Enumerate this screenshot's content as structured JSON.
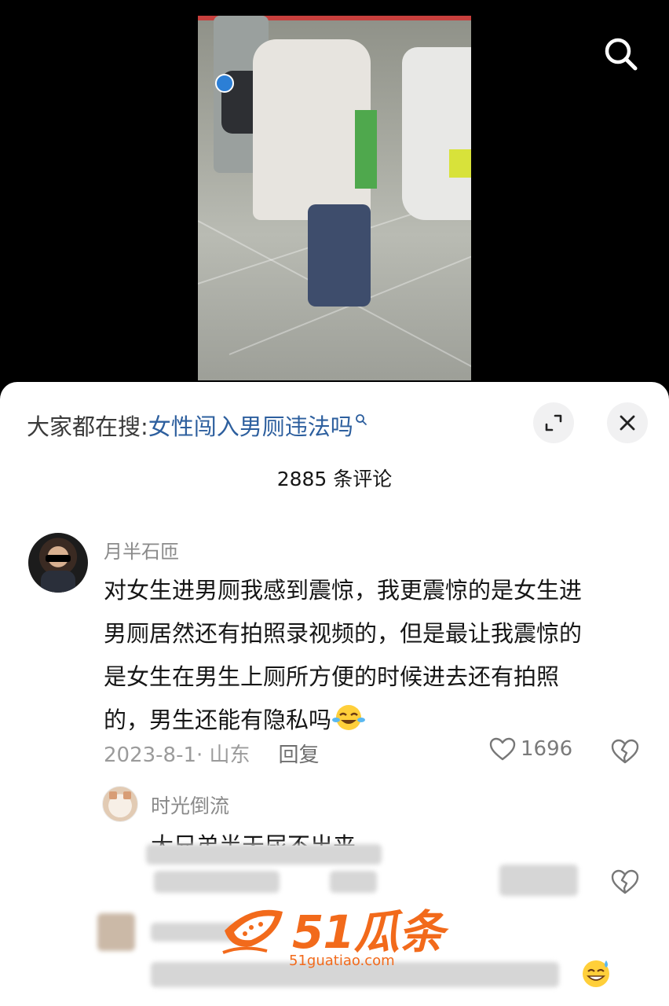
{
  "video": {
    "badge_text": "",
    "watermark": "",
    "search_icon": "search-icon"
  },
  "panel": {
    "hot_search_prefix": "大家都在搜:",
    "hot_search_query": "女性闯入男厕违法吗",
    "expand_icon": "expand-icon",
    "close_icon": "close-icon",
    "comment_count": "2885 条评论"
  },
  "comments": [
    {
      "username": "月半石匝",
      "text": "对女生进男厕我感到震惊，我更震惊的是女生进男厕居然还有拍照录视频的，但是最让我震惊的是女生在男生上厕所方便的时候进去还有拍照的，男生还能有隐私吗",
      "lines": [
        "对女生进男厕我感到震惊，我更震惊的是女生进",
        "男厕居然还有拍照录视频的，但是最让我震惊的",
        "是女生在男生上厕所方便的时候进去还有拍照",
        "的，男生还能有隐私吗"
      ],
      "emoji": "laughing-crying-emoji",
      "date": "2023-8-1",
      "location": "· 山东",
      "reply_label": "回复",
      "likes": "1696"
    }
  ],
  "reply": {
    "username": "时光倒流",
    "text": "大兄弟半天尿不出来"
  },
  "watermark_logo": {
    "brand": "51瓜条",
    "domain": "51guatiao.com"
  },
  "colors": {
    "link": "#2d5f9e",
    "brand": "#f26a1b",
    "muted": "#8a8a8a"
  }
}
